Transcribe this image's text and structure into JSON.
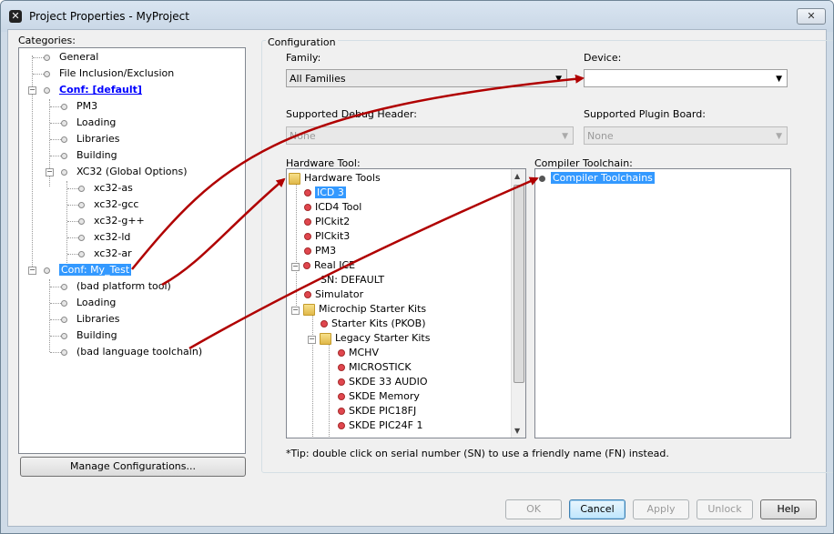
{
  "window": {
    "title": "Project Properties - MyProject",
    "close_label": "✕"
  },
  "categories": {
    "label": "Categories:",
    "items": [
      "General",
      "File Inclusion/Exclusion",
      "Conf: [default]",
      "PM3",
      "Loading",
      "Libraries",
      "Building",
      "XC32 (Global Options)",
      "xc32-as",
      "xc32-gcc",
      "xc32-g++",
      "xc32-ld",
      "xc32-ar",
      "Conf: My_Test",
      "(bad platform tool)",
      "Loading",
      "Libraries",
      "Building",
      "(bad language toolchain)"
    ]
  },
  "manage_button": "Manage Configurations...",
  "config": {
    "group_label": "Configuration",
    "family_label": "Family:",
    "family_value": "All Families",
    "device_label": "Device:",
    "device_value": "",
    "debug_header_label": "Supported Debug Header:",
    "debug_header_value": "None",
    "plugin_board_label": "Supported Plugin Board:",
    "plugin_board_value": "None",
    "hardware_tool_label": "Hardware Tool:",
    "compiler_toolchain_label": "Compiler Toolchain:",
    "hardware_tools": [
      "Hardware Tools",
      "ICD 3",
      "ICD4 Tool",
      "PICkit2",
      "PICkit3",
      "PM3",
      "Real ICE",
      "SN: DEFAULT",
      "Simulator",
      "Microchip Starter Kits",
      "Starter Kits (PKOB)",
      "Legacy Starter Kits",
      "MCHV",
      "MICROSTICK",
      "SKDE 33 AUDIO",
      "SKDE Memory",
      "SKDE PIC18FJ",
      "SKDE PIC24F 1"
    ],
    "compiler_items": [
      "Compiler Toolchains"
    ],
    "tip": "*Tip: double click on serial number (SN) to use a friendly name (FN) instead."
  },
  "buttons": {
    "ok": "OK",
    "cancel": "Cancel",
    "apply": "Apply",
    "unlock": "Unlock",
    "help": "Help"
  },
  "colors": {
    "arrow": "#b00000",
    "selection": "#3399ff",
    "link": "#0000ff"
  }
}
